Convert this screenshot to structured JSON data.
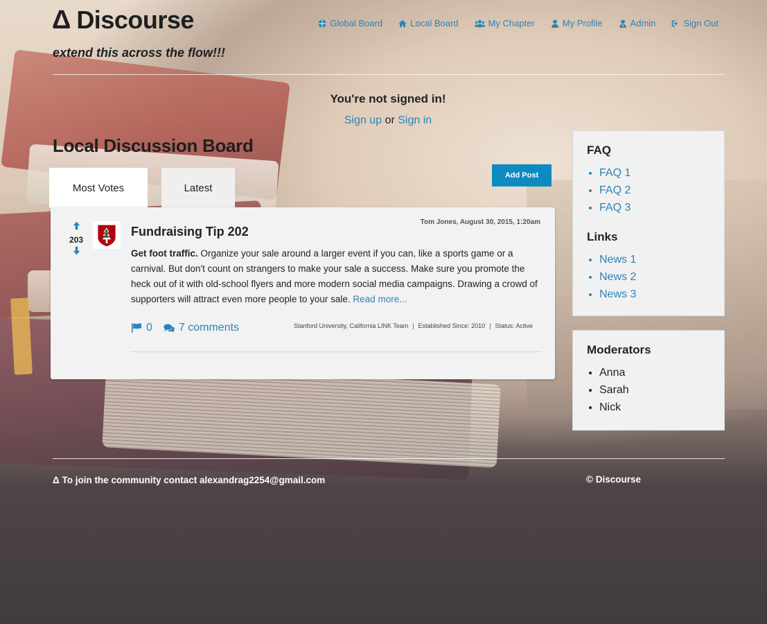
{
  "brand": {
    "symbol": "Δ",
    "name": "Discourse",
    "tagline": "extend this across the flow!!!"
  },
  "nav": {
    "items": [
      {
        "label": "Global Board",
        "icon": "globe-icon"
      },
      {
        "label": "Local Board",
        "icon": "home-icon"
      },
      {
        "label": "My Chapter",
        "icon": "users-icon"
      },
      {
        "label": "My Profile",
        "icon": "user-icon"
      },
      {
        "label": "Admin",
        "icon": "admin-user-icon"
      },
      {
        "label": "Sign Out",
        "icon": "sign-out-icon"
      }
    ],
    "link_color": "#2a84b7"
  },
  "signin": {
    "notice": "You're not signed in!",
    "signup": "Sign up",
    "or": "or",
    "signin": "Sign in"
  },
  "board": {
    "title": "Local Discussion Board",
    "tabs": [
      {
        "label": "Most Votes",
        "active": true
      },
      {
        "label": "Latest",
        "active": false
      }
    ],
    "add_post": "Add Post"
  },
  "post": {
    "votes": "203",
    "meta": "Tom Jones, August 30, 2015, 1:20am",
    "title": "Fundraising Tip 202",
    "lead": "Get foot traffic.",
    "body": " Organize your sale around a larger event if you can, like a sports game or a carnival. But don't count on strangers to make your sale a success. Make sure you promote the heck out of it with old-school flyers and more modern social media campaigns. Drawing a crowd of supporters will attract even more people to your sale. ",
    "read_more": "Read more...",
    "flags": "0",
    "comments": "7 comments",
    "team": "Stanford University, California LINK Team",
    "established": "Established Since: 2010",
    "status": "Status: Active",
    "sep": "|"
  },
  "sidebar": {
    "faq": {
      "title": "FAQ",
      "items": [
        "FAQ 1",
        "FAQ 2",
        "FAQ 3"
      ]
    },
    "links": {
      "title": "Links",
      "items": [
        "News 1",
        "News 2",
        "News 3"
      ]
    },
    "moderators": {
      "title": "Moderators",
      "items": [
        "Anna",
        "Sarah",
        "Nick"
      ]
    }
  },
  "footer": {
    "contact": "Δ To join the community contact alexandrag2254@gmail.com",
    "copyright": "© Discourse"
  },
  "colors": {
    "accent": "#0d8bc0",
    "link": "#2a84b7"
  }
}
